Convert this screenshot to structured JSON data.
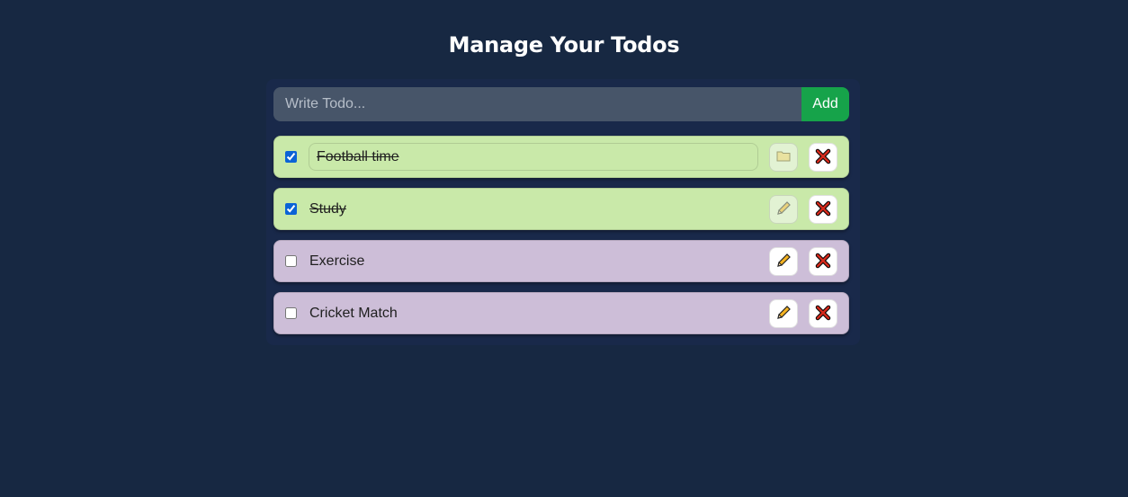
{
  "header": {
    "title": "Manage Your Todos"
  },
  "form": {
    "placeholder": "Write Todo...",
    "value": "",
    "add_label": "Add"
  },
  "todos": [
    {
      "text": "Football time",
      "completed": true,
      "editing": true,
      "status_color": "#c9e9a9"
    },
    {
      "text": "Study",
      "completed": true,
      "editing": false,
      "status_color": "#c9e9a9"
    },
    {
      "text": "Exercise",
      "completed": false,
      "editing": false,
      "status_color": "#cdbed8"
    },
    {
      "text": "Cricket Match",
      "completed": false,
      "editing": false,
      "status_color": "#cdbed8"
    }
  ],
  "colors": {
    "background": "#172842",
    "input_bg": "#475569",
    "add_button": "#16a34a",
    "completed": "#c9e9a9",
    "pending": "#cdbed8"
  },
  "icons": {
    "save": "folder-icon",
    "edit": "pencil-icon",
    "delete": "close-icon"
  }
}
